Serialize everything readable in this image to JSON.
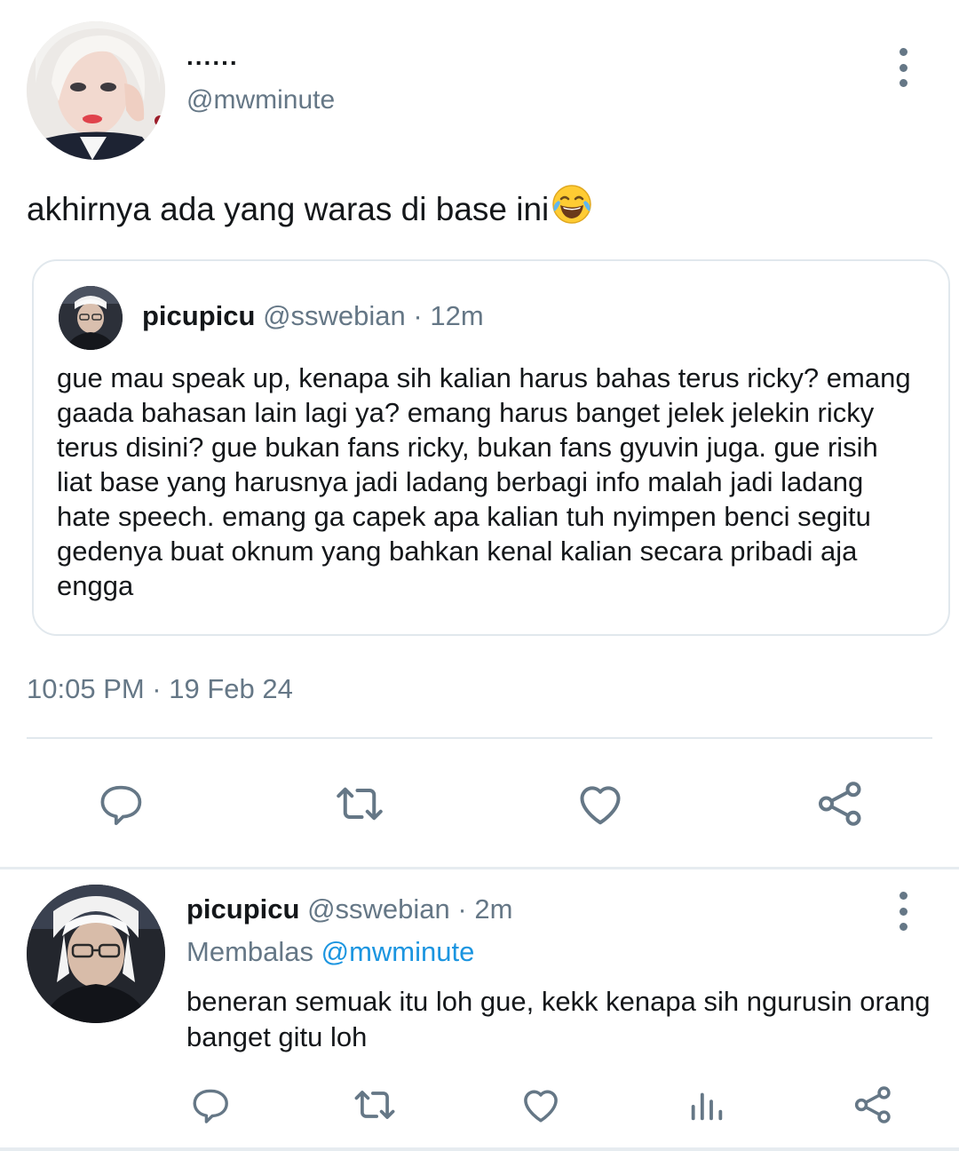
{
  "main_tweet": {
    "display_name": "......",
    "handle": "@mwminute",
    "text": "akhirnya ada yang waras di base ini",
    "emoji": "face-with-tears-of-joy",
    "timestamp": "10:05 PM · 19 Feb 24",
    "quote": {
      "name": "picupicu",
      "handle": "@sswebian",
      "time": "· 12m",
      "text": "gue mau speak up, kenapa sih kalian harus bahas terus ricky? emang gaada bahasan lain lagi ya? emang harus banget jelek jelekin ricky terus disini? gue bukan fans ricky, bukan fans gyuvin juga. gue risih liat base yang harusnya jadi ladang berbagi info malah jadi ladang hate speech. emang ga capek apa kalian tuh nyimpen benci segitu gedenya buat oknum yang bahkan kenal kalian secara pribadi aja engga"
    }
  },
  "reply_tweet": {
    "name": "picupicu",
    "handle": "@sswebian",
    "time": "· 2m",
    "replying_label": "Membalas",
    "replying_to": "@mwminute",
    "text": "beneran semuak itu loh gue, kekk kenapa sih ngurusin orang banget gitu loh"
  },
  "icons": {
    "reply": "reply-icon",
    "retweet": "retweet-icon",
    "like": "heart-icon",
    "share": "share-icon",
    "analytics": "analytics-icon",
    "more": "more-vertical-icon"
  },
  "colors": {
    "secondary_text": "#657786",
    "link": "#1b95e0",
    "border": "#e1e8ed"
  }
}
